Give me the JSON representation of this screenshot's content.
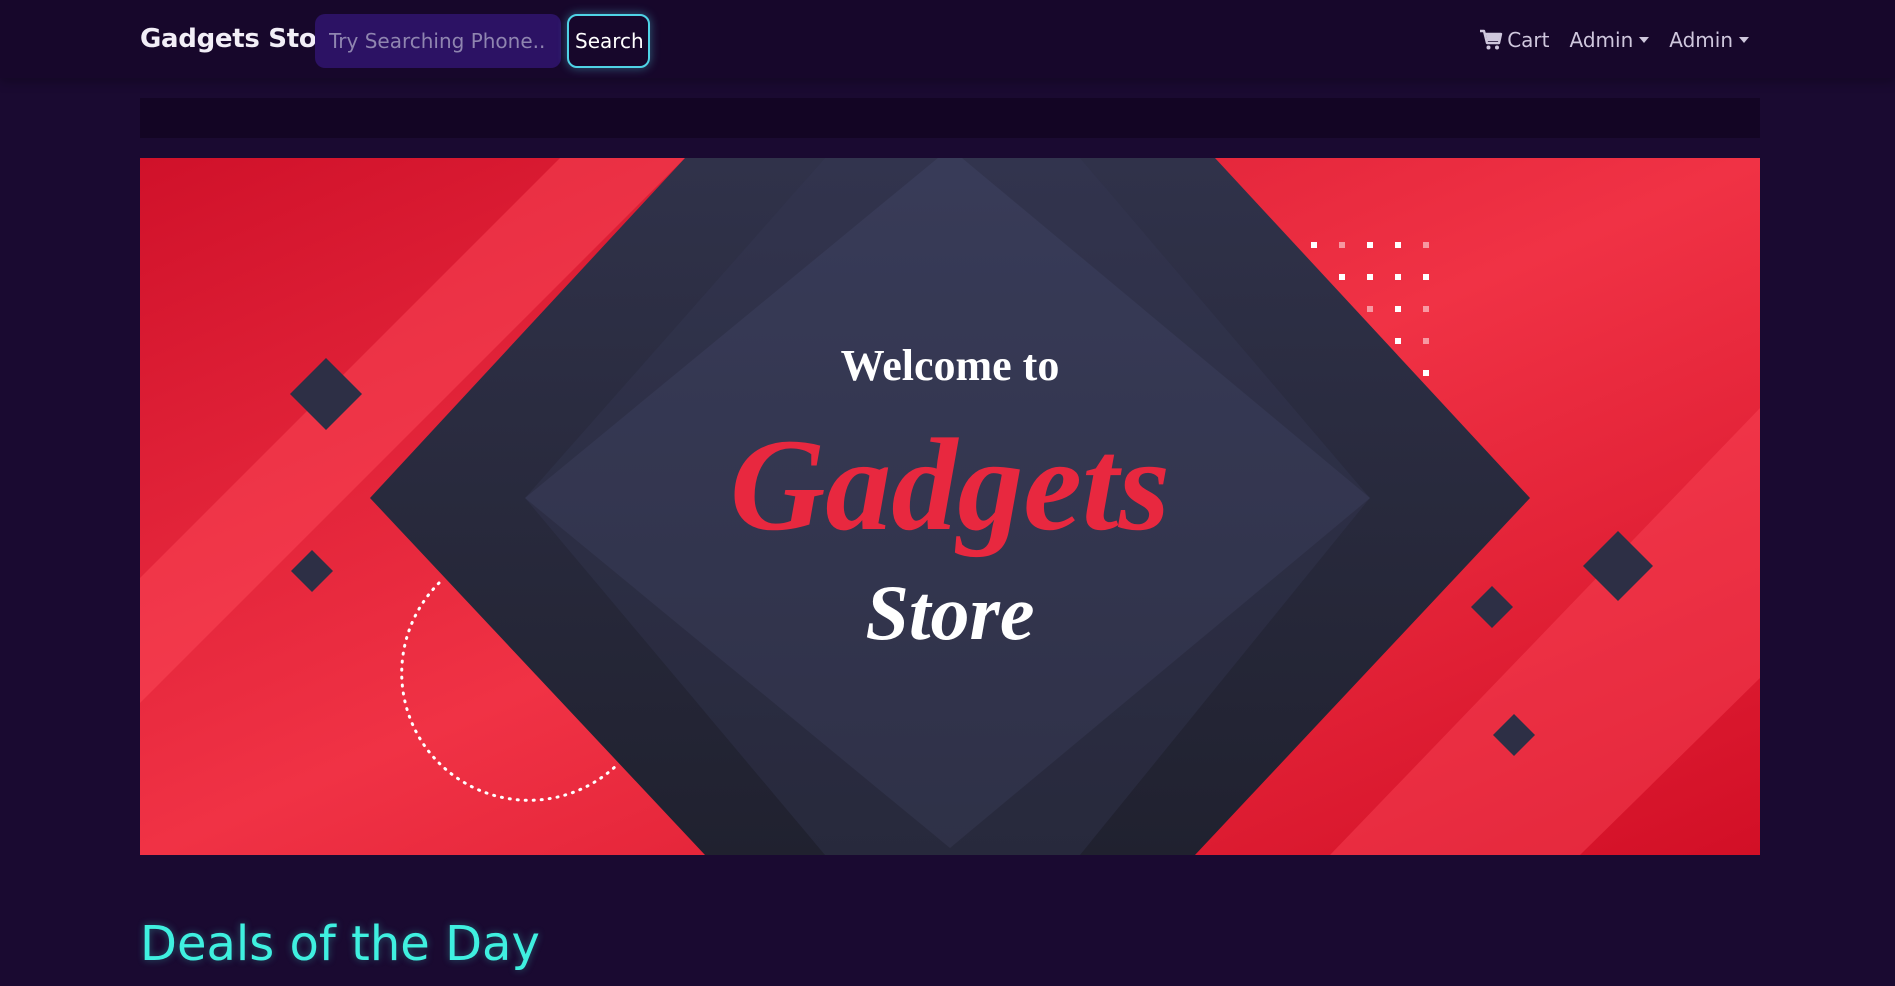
{
  "navbar": {
    "brand": "Gadgets Store",
    "search_placeholder": "Try Searching Phone..",
    "search_button": "Search",
    "cart_label": "Cart",
    "cart_icon": "cart-icon",
    "admin_menu_1": "Admin",
    "admin_menu_2": "Admin"
  },
  "banner": {
    "line1": "Welcome to",
    "line2": "Gadgets",
    "line3": "Store"
  },
  "sections": {
    "deals_title": "Deals of the Day"
  },
  "colors": {
    "background": "#1a0a31",
    "navbar": "#17072b",
    "accent_cyan": "#3ff0e0",
    "banner_red": "#e8283f",
    "banner_dark": "#2c2f45"
  }
}
